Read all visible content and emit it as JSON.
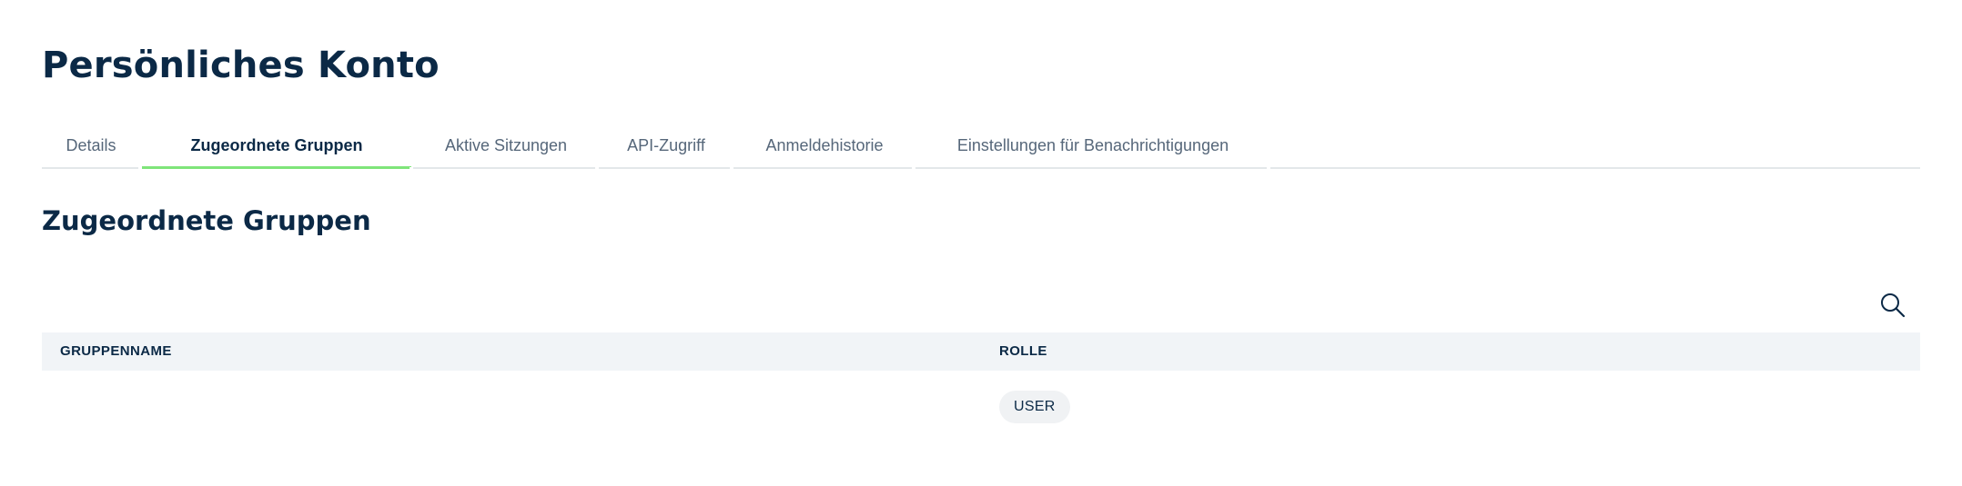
{
  "page": {
    "title": "Persönliches Konto"
  },
  "tabs": [
    {
      "label": "Details",
      "active": false
    },
    {
      "label": "Zugeordnete Gruppen",
      "active": true
    },
    {
      "label": "Aktive Sitzungen",
      "active": false
    },
    {
      "label": "API-Zugriff",
      "active": false
    },
    {
      "label": "Anmeldehistorie",
      "active": false
    },
    {
      "label": "Einstellungen für Benachrichtigungen",
      "active": false
    }
  ],
  "section": {
    "title": "Zugeordnete Gruppen"
  },
  "toolbar": {
    "search_icon": "search-icon"
  },
  "table": {
    "columns": [
      "GRUPPENNAME",
      "ROLLE"
    ],
    "rows": [
      {
        "group_name": "",
        "role": "USER"
      }
    ]
  },
  "colors": {
    "text_primary": "#0b2946",
    "tab_inactive": "#56677a",
    "tab_active_underline": "#7fe57a",
    "table_header_bg": "#f1f4f7",
    "badge_bg": "#f0f2f4"
  }
}
